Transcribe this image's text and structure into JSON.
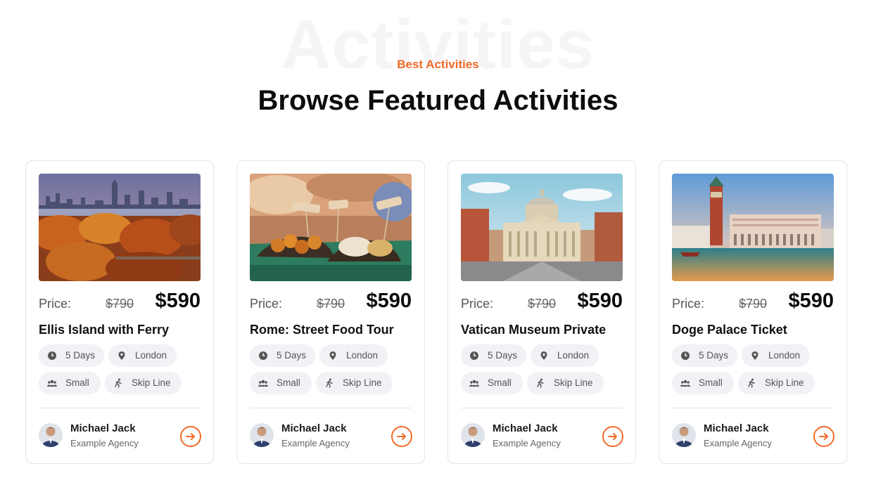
{
  "section": {
    "background_word": "Activities",
    "eyebrow": "Best Activities",
    "title": "Browse Featured Activities",
    "accent_color": "#f26b2a"
  },
  "cards": [
    {
      "image": "new-york-skyline-autumn-image",
      "price_label": "Price:",
      "price_old": "$790",
      "price_new": "$590",
      "name": "Ellis Island with Ferry",
      "duration": "5 Days",
      "location": "London",
      "group": "Small",
      "feature": "Skip Line",
      "agent_name": "Michael Jack",
      "agent_org": "Example Agency"
    },
    {
      "image": "street-food-image",
      "price_label": "Price:",
      "price_old": "$790",
      "price_new": "$590",
      "name": "Rome: Street Food Tour",
      "duration": "5 Days",
      "location": "London",
      "group": "Small",
      "feature": "Skip Line",
      "agent_name": "Michael Jack",
      "agent_org": "Example Agency"
    },
    {
      "image": "vatican-basilica-image",
      "price_label": "Price:",
      "price_old": "$790",
      "price_new": "$590",
      "name": "Vatican Museum Private",
      "duration": "5 Days",
      "location": "London",
      "group": "Small",
      "feature": "Skip Line",
      "agent_name": "Michael Jack",
      "agent_org": "Example Agency"
    },
    {
      "image": "venice-doge-palace-image",
      "price_label": "Price:",
      "price_old": "$790",
      "price_new": "$590",
      "name": "Doge Palace Ticket",
      "duration": "5 Days",
      "location": "London",
      "group": "Small",
      "feature": "Skip Line",
      "agent_name": "Michael Jack",
      "agent_org": "Example Agency"
    }
  ],
  "icons": {
    "duration": "clock-icon",
    "location": "map-pin-icon",
    "group": "users-icon",
    "feature": "running-person-icon",
    "action": "arrow-right-circle-icon"
  }
}
